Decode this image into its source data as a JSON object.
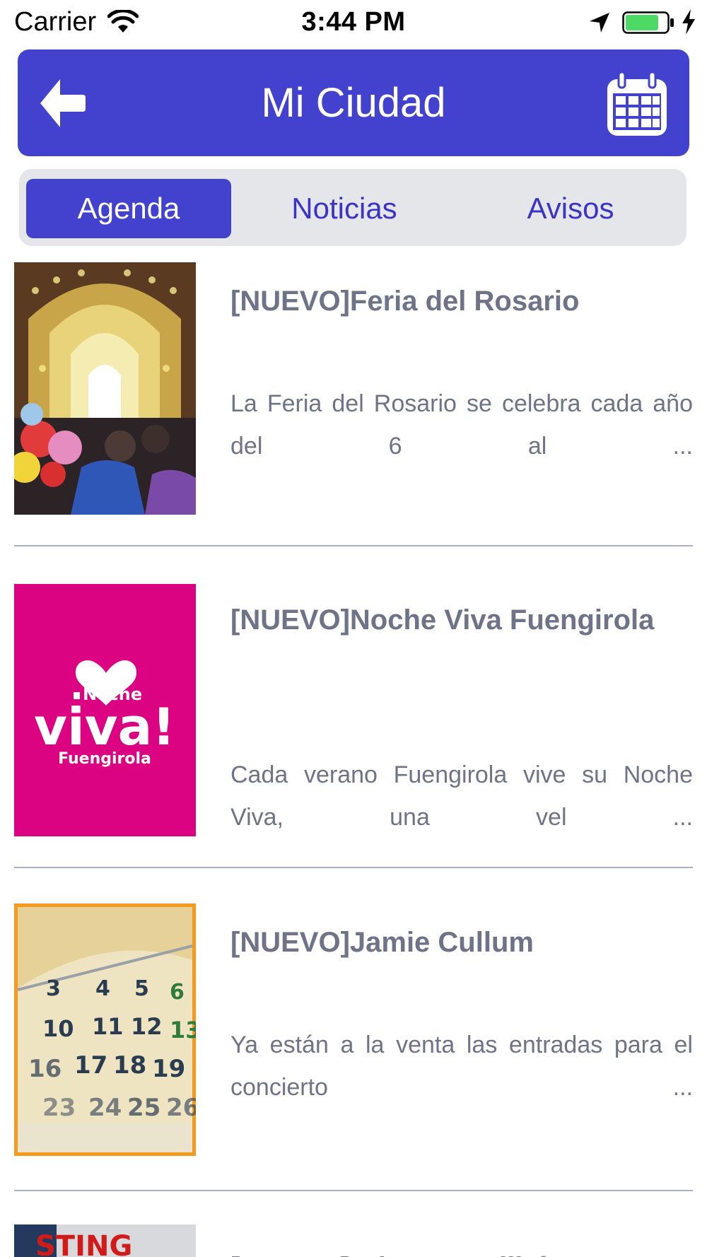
{
  "status_bar": {
    "carrier": "Carrier",
    "time": "3:44 PM",
    "battery_color": "#4cd964"
  },
  "header": {
    "title": "Mi Ciudad",
    "background": "#4242cf",
    "back_icon": "back-arrow-icon",
    "calendar_icon": "calendar-icon"
  },
  "tabs": [
    {
      "label": "Agenda",
      "active": true
    },
    {
      "label": "Noticias",
      "active": false
    },
    {
      "label": "Avisos",
      "active": false
    }
  ],
  "items": [
    {
      "title": "[NUEVO]Feria del Rosario",
      "description": "La Feria del Rosario se celebra cada año del 6 al ...",
      "image": "feria-photo"
    },
    {
      "title": "[NUEVO]Noche Viva Fuengirola",
      "description": "Cada verano Fuengirola vive su Noche Viva, una vel ...",
      "image": "noche-viva-logo",
      "image_text": [
        "Noche",
        "viva!",
        "Fuengirola"
      ]
    },
    {
      "title": "[NUEVO]Jamie Cullum",
      "description": "Ya están a la venta las entradas para el concierto ...",
      "image": "calendar-photo"
    },
    {
      "title": "[NUEVO]Sting ... Malibú",
      "image": "sting-poster",
      "image_text": [
        "STING"
      ]
    }
  ]
}
